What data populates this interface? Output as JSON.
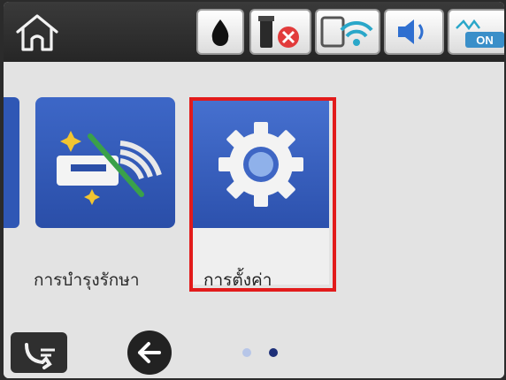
{
  "status_bar": {
    "icons": [
      "home-icon",
      "ink-drop-icon",
      "printer-error-icon",
      "wifi-direct-icon",
      "speaker-icon",
      "quiet-mode-icon"
    ],
    "quiet_badge": "ON"
  },
  "menu": {
    "items": [
      {
        "label": "การบำรุงรักษา",
        "icon": "maintenance-icon",
        "selected": false
      },
      {
        "label": "การตั้งค่า",
        "icon": "gear-icon",
        "selected": true
      }
    ]
  },
  "pager": {
    "current_page": 2,
    "total_pages": 2
  },
  "colors": {
    "tile_blue": "#2f57b5",
    "selection": "#e21b1b",
    "error_badge": "#e23b3b",
    "active_dot": "#1d2f78"
  }
}
